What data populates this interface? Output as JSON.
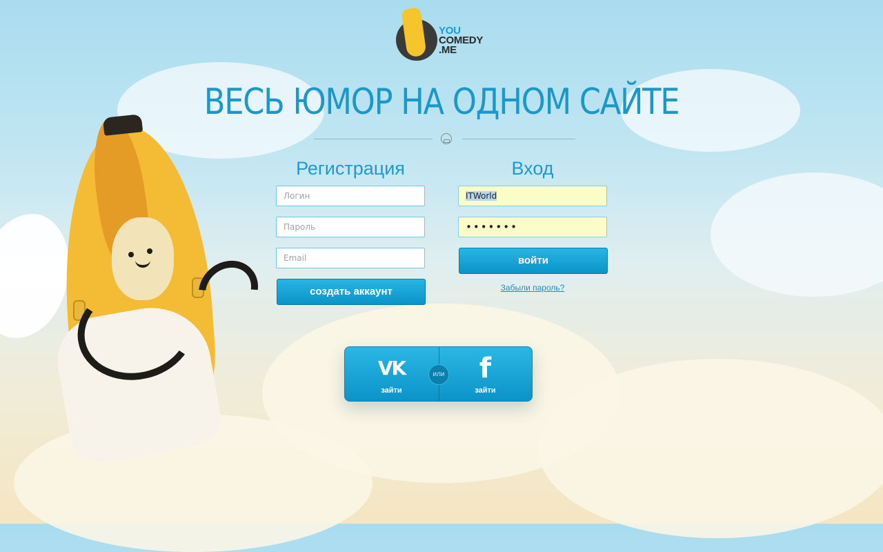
{
  "logo": {
    "line1": "YOU",
    "line2": "COMEDY",
    "line3": ".ME"
  },
  "headline": "ВЕСЬ ЮМОР НА ОДНОМ САЙТЕ",
  "register": {
    "title": "Регистрация",
    "login_placeholder": "Логин",
    "password_placeholder": "Пароль",
    "email_placeholder": "Email",
    "submit_label": "создать аккаунт"
  },
  "login": {
    "title": "Вход",
    "username_value": "ITWorld",
    "password_value": "•••••••",
    "submit_label": "войти",
    "forgot_label": "Забыли пароль?"
  },
  "social": {
    "vk_icon": "vk-icon",
    "vk_label": "зайти",
    "or_label": "или",
    "fb_icon": "facebook-icon",
    "fb_label": "зайти"
  },
  "colors": {
    "accent": "#1c98c8",
    "button": "#0a94c9",
    "autofill": "#fbfdc9"
  }
}
